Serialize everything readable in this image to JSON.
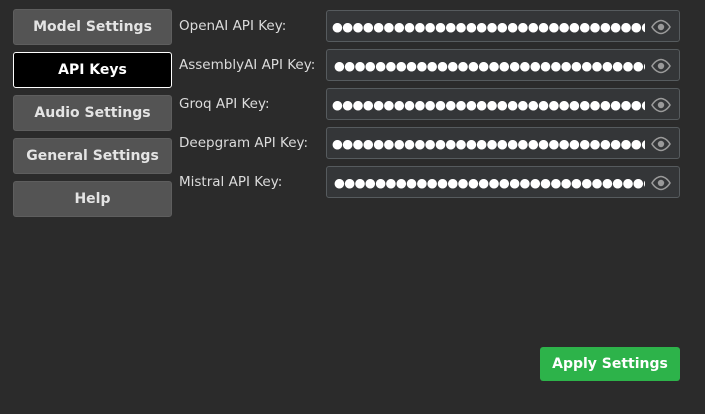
{
  "sidebar": {
    "items": [
      {
        "label": "Model Settings",
        "active": false
      },
      {
        "label": "API Keys",
        "active": true
      },
      {
        "label": "Audio Settings",
        "active": false
      },
      {
        "label": "General Settings",
        "active": false
      },
      {
        "label": "Help",
        "active": false
      }
    ]
  },
  "api_keys": {
    "fields": [
      {
        "label": "OpenAI API Key:",
        "value": "●●●●●●●●●●●●●●●●●●●●●●●●●●●●●●●●●●●●●●●●●●●●●●●●●●●●●",
        "icon": "eye-icon"
      },
      {
        "label": "AssemblyAI API Key:",
        "value": "●●●●●●●●●●●●●●●●●●●●●●●●●●●●●●●●",
        "icon": "eye-icon"
      },
      {
        "label": "Groq API Key:",
        "value": "●●●●●●●●●●●●●●●●●●●●●●●●●●●●●●●●●●●●●●●●●●●●●●●●●●●●●",
        "icon": "eye-icon"
      },
      {
        "label": "Deepgram API Key:",
        "value": "●●●●●●●●●●●●●●●●●●●●●●●●●●●●●●●●●●●●●●●●",
        "icon": "eye-icon"
      },
      {
        "label": "Mistral API Key:",
        "value": "●●●●●●●●●●●●●●●●●●●●●●●●●●●●●●●●",
        "icon": "eye-icon"
      }
    ]
  },
  "footer": {
    "apply_label": "Apply Settings"
  },
  "colors": {
    "background": "#2b2b2b",
    "nav_button": "#545454",
    "nav_active": "#000000",
    "input_bg": "#343638",
    "input_border": "#565b5e",
    "apply_button": "#2db34a"
  }
}
